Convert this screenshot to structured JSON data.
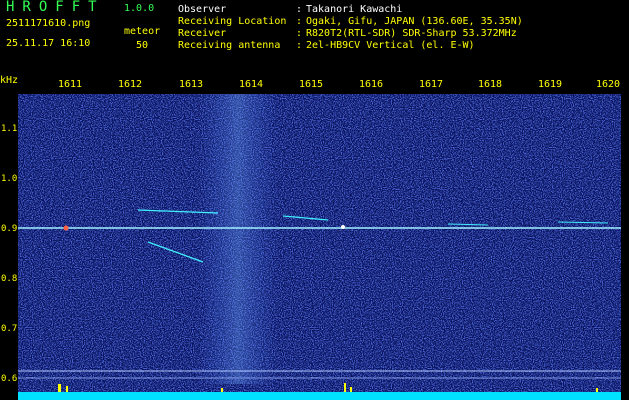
{
  "header": {
    "app_title": "HROFFT",
    "app_version": "1.0.0",
    "file_name": "2511171610.png",
    "date_time": "25.11.17 16:10",
    "meteor_label": "meteor",
    "meteor_count": "50",
    "info": [
      {
        "label": "Observer",
        "sep": ":",
        "value": "Takanori Kawachi"
      },
      {
        "label": "Receiving Location",
        "sep": ":",
        "value": "Ogaki, Gifu, JAPAN (136.60E, 35.35N)"
      },
      {
        "label": "Receiver",
        "sep": ":",
        "value": "R820T2(RTL-SDR) SDR-Sharp 53.372MHz"
      },
      {
        "label": "Receiving antenna",
        "sep": ":",
        "value": "2el-HB9CV Vertical (el. E-W)"
      }
    ]
  },
  "axes": {
    "y_unit": "kHz",
    "x_ticks": [
      "1611",
      "1612",
      "1613",
      "1614",
      "1615",
      "1616",
      "1617",
      "1618",
      "1619",
      "1620"
    ],
    "y_ticks": [
      "1.1",
      "1.0",
      "0.9",
      "0.8",
      "0.7",
      "0.6"
    ]
  },
  "colors": {
    "background": "#000000",
    "label_yellow": "#ffff00",
    "title_green": "#33ff55",
    "noise_blue": "#1a2fd0",
    "carrier_cyan": "#a0f0ff",
    "baseline_cyan": "#00e0ff"
  }
}
